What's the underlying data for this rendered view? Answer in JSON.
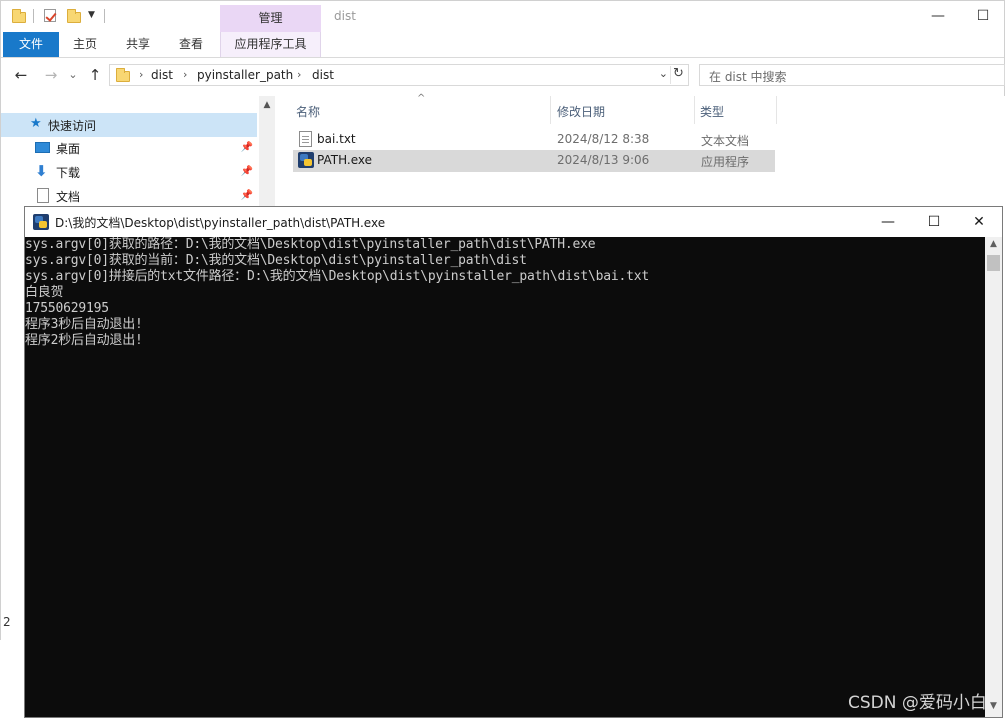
{
  "explorer": {
    "window_title": "dist",
    "manage_tab": "管理",
    "ribbon_tabs": [
      "文件",
      "主页",
      "共享",
      "查看",
      "应用程序工具"
    ],
    "window_controls": {
      "minimize": "—",
      "maximize": "☐"
    },
    "nav": {
      "back": "←",
      "forward": "→",
      "up": "↑",
      "recent": "⌄"
    },
    "address": {
      "crumbs": [
        "dist",
        "pyinstaller_path",
        "dist"
      ],
      "sep": "›",
      "dropdown": "⌄",
      "refresh": "↻"
    },
    "search_placeholder": "在 dist 中搜索",
    "navpane": {
      "items": [
        {
          "label": "快速访问",
          "icon": "star-icon",
          "pinned": false
        },
        {
          "label": "桌面",
          "icon": "desktop-icon",
          "pinned": true
        },
        {
          "label": "下载",
          "icon": "download-icon",
          "pinned": true
        },
        {
          "label": "文档",
          "icon": "document-icon",
          "pinned": true
        }
      ],
      "pin_glyph": "📌",
      "scroll_up": "▲"
    },
    "status_fragment": "2",
    "columns": {
      "name": "名称",
      "date": "修改日期",
      "type": "类型",
      "sort_glyph": "^"
    },
    "files": [
      {
        "name": "bai.txt",
        "date": "2024/8/12 8:38",
        "type": "文本文档",
        "icon": "text-file-icon"
      },
      {
        "name": "PATH.exe",
        "date": "2024/8/13 9:06",
        "type": "应用程序",
        "icon": "exe-icon"
      }
    ]
  },
  "console": {
    "title": "D:\\我的文档\\Desktop\\dist\\pyinstaller_path\\dist\\PATH.exe",
    "controls": {
      "minimize": "—",
      "maximize": "☐",
      "close": "✕"
    },
    "lines": [
      "sys.argv[0]获取的路径：D:\\我的文档\\Desktop\\dist\\pyinstaller_path\\dist\\PATH.exe",
      "sys.argv[0]获取的当前：D:\\我的文档\\Desktop\\dist\\pyinstaller_path\\dist",
      "sys.argv[0]拼接后的txt文件路径：D:\\我的文档\\Desktop\\dist\\pyinstaller_path\\dist\\bai.txt",
      "白良贺",
      "17550629195",
      "程序3秒后自动退出!",
      "程序2秒后自动退出!"
    ],
    "scroll": {
      "up": "▲",
      "down": "▼"
    }
  },
  "watermark": "CSDN @爱码小白",
  "colors": {
    "accent": "#1979ca",
    "manage_tab": "#ead7f5",
    "selection": "#cce4f7",
    "console_bg": "#0c0c0c",
    "console_text": "#cccccc"
  }
}
